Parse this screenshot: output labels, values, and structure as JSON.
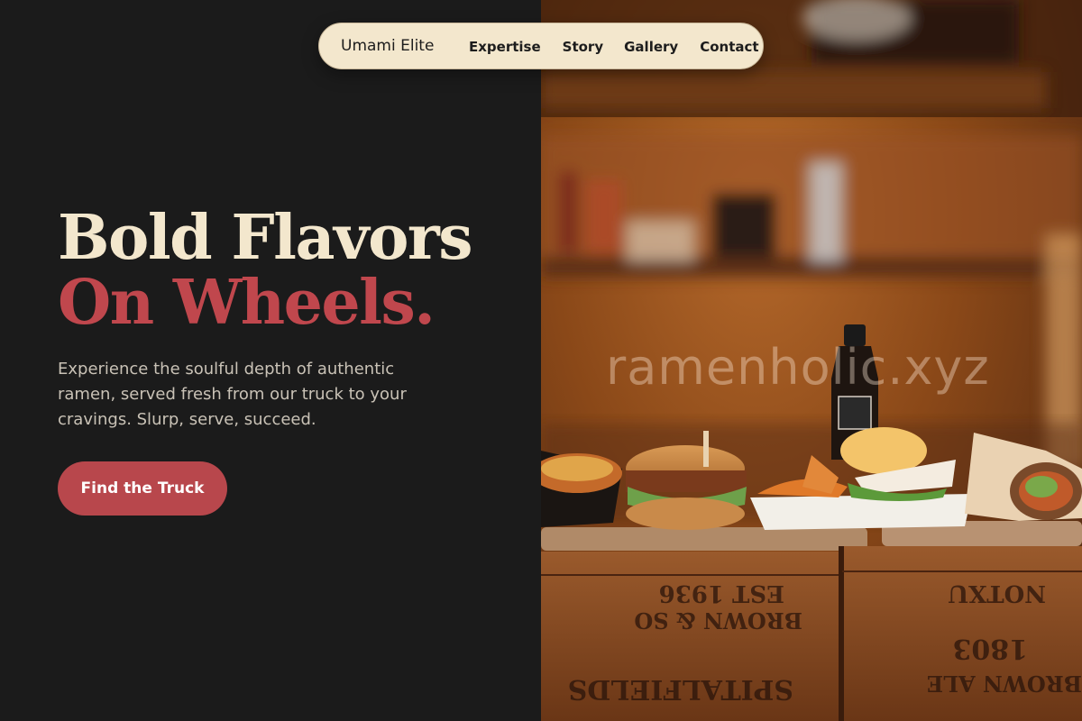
{
  "nav": {
    "brand": "Umami Elite",
    "links": [
      {
        "label": "Expertise"
      },
      {
        "label": "Story"
      },
      {
        "label": "Gallery"
      },
      {
        "label": "Contact"
      }
    ]
  },
  "hero": {
    "title_line1": "Bold Flavors",
    "title_line2": "On Wheels.",
    "subtitle": "Experience the soulful depth of authentic ramen, served fresh from our truck to your cravings. Slurp, serve, succeed.",
    "cta_label": "Find the Truck"
  },
  "photo": {
    "watermark": "ramenholic.xyz",
    "crate_text": [
      "EST 1936",
      "BROWN & SO",
      "SPITALFIELDS",
      "NOTXU",
      "1803",
      "BROWN ALE"
    ]
  },
  "colors": {
    "background": "#1b1b1b",
    "cream": "#f3e7cd",
    "accent": "#c0474d",
    "button": "#b8474c",
    "body_text": "#c9c2b6"
  }
}
